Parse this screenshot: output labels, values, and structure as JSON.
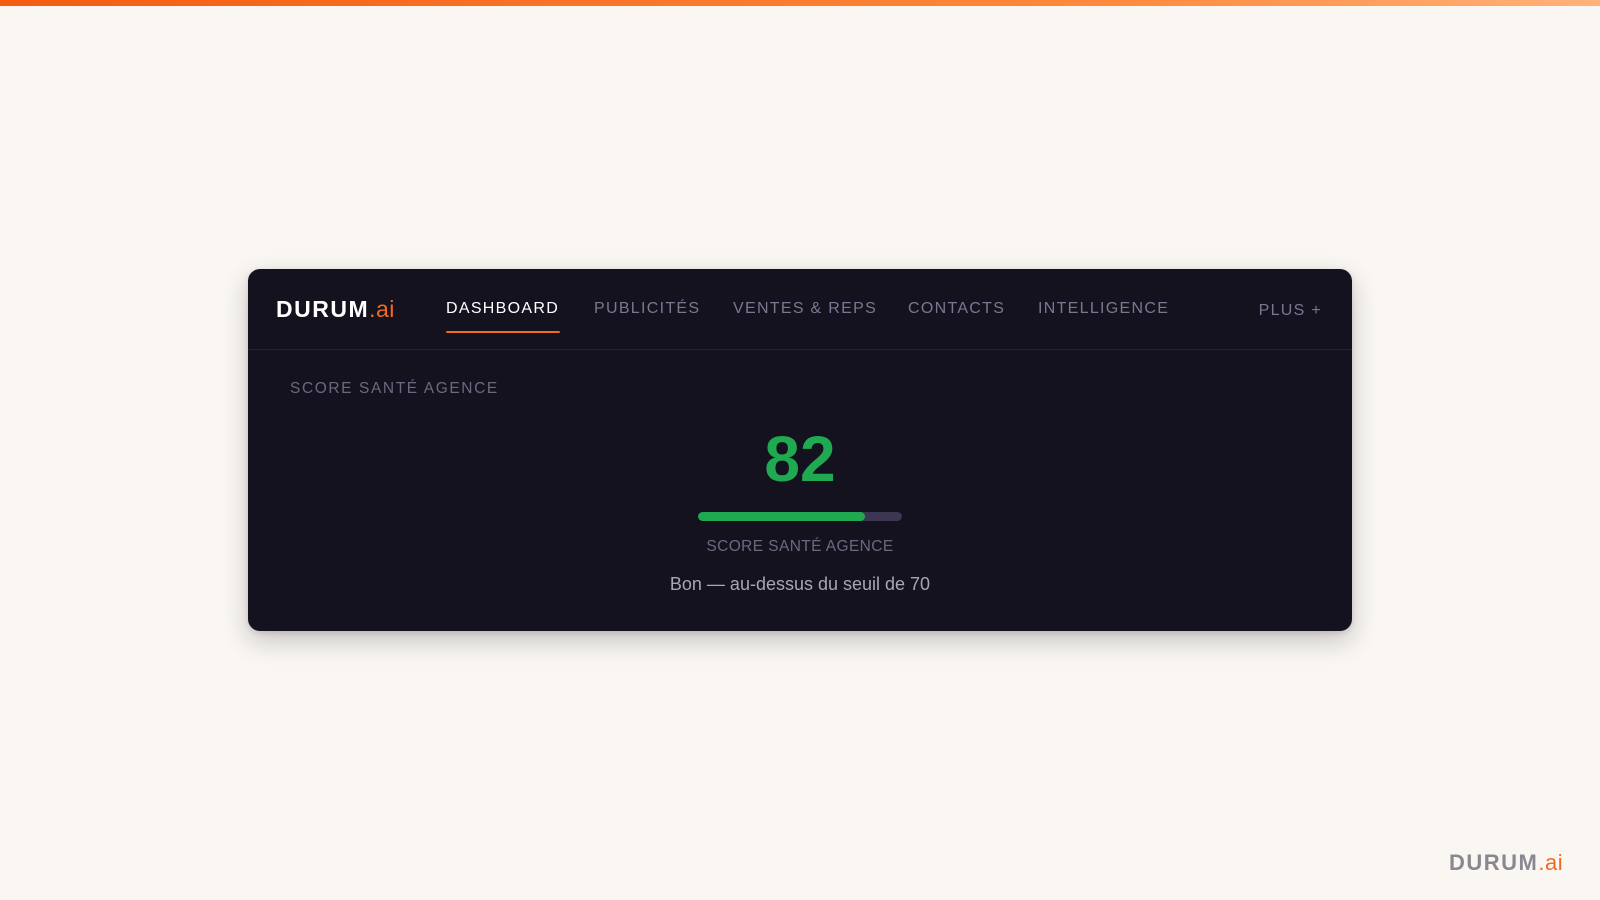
{
  "colors": {
    "page_background": "#faf7f2",
    "app_background": "#14121f",
    "accent": "#f26a21",
    "score_good": "#1fa951",
    "muted_text": "#7c7790"
  },
  "brand": {
    "name": "DURUM",
    "suffix": ".ai"
  },
  "nav": {
    "tabs": [
      {
        "label": "DASHBOARD",
        "active": true
      },
      {
        "label": "PUBLICITÉS",
        "active": false
      },
      {
        "label": "VENTES & REPS",
        "active": false
      },
      {
        "label": "CONTACTS",
        "active": false
      },
      {
        "label": "INTELLIGENCE",
        "active": false
      }
    ],
    "more_label": "PLUS +"
  },
  "panel": {
    "section_label": "SCORE SANTÉ AGENCE",
    "score": "82",
    "score_progress": 0.82,
    "caption": "SCORE SANTÉ AGENCE",
    "status": "Bon — au-dessus du seuil de 70"
  },
  "footer": {
    "brand_name": "DURUM",
    "brand_suffix": ".ai"
  }
}
